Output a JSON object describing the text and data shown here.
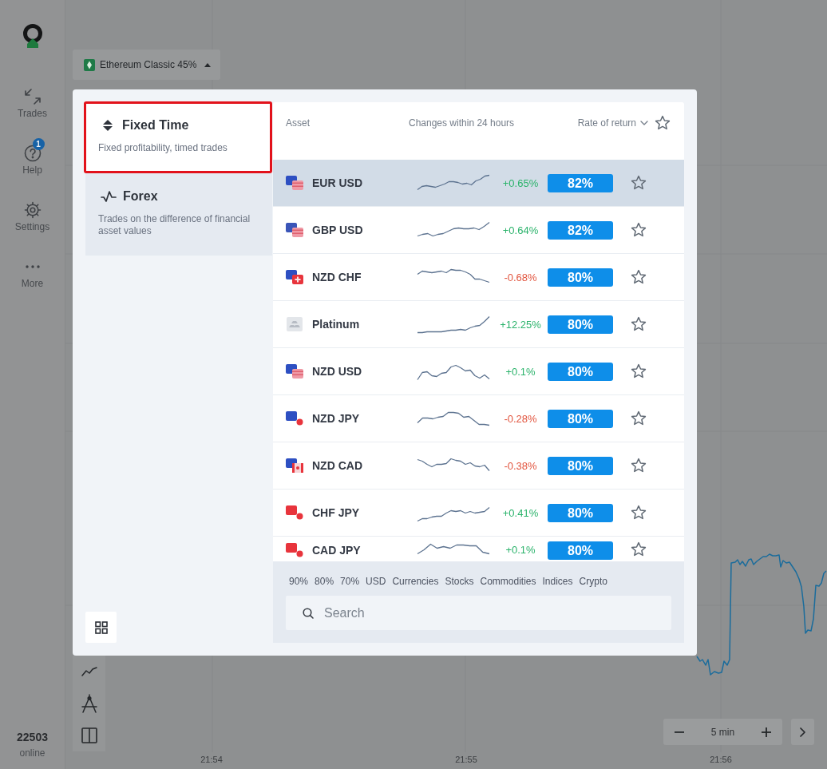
{
  "sidebar": {
    "items": [
      {
        "label": "Trades"
      },
      {
        "label": "Help",
        "badge": "1"
      },
      {
        "label": "Settings"
      },
      {
        "label": "More"
      }
    ],
    "online_count": "22503",
    "online_label": "online"
  },
  "asset_selector": {
    "name": "Ethereum Classic",
    "percent": "45%",
    "expanded": true
  },
  "asset_dialog": {
    "tabs": [
      {
        "title": "Fixed Time",
        "description": "Fixed profitability, timed trades",
        "selected": true
      },
      {
        "title": "Forex",
        "description": "Trades on the difference of financial asset values",
        "selected": false
      }
    ],
    "table": {
      "columns": [
        "Asset",
        "Changes within 24 hours",
        "Rate of return"
      ],
      "rows": [
        {
          "name": "EUR USD",
          "kind": "currency",
          "change": "+0.65%",
          "color": "#2bb36b",
          "rate": "82%",
          "selected": true,
          "favorite": false
        },
        {
          "name": "GBP USD",
          "kind": "currency",
          "change": "+0.64%",
          "color": "#2bb36b",
          "rate": "82%",
          "selected": false,
          "favorite": false
        },
        {
          "name": "NZD CHF",
          "kind": "currency",
          "change": "-0.68%",
          "color": "#e2553f",
          "rate": "80%",
          "selected": false,
          "favorite": false
        },
        {
          "name": "Platinum",
          "kind": "commodity",
          "change": "+12.25%",
          "color": "#2bb36b",
          "rate": "80%",
          "selected": false,
          "favorite": false
        },
        {
          "name": "NZD USD",
          "kind": "currency",
          "change": "+0.1%",
          "color": "#2bb36b",
          "rate": "80%",
          "selected": false,
          "favorite": false
        },
        {
          "name": "NZD JPY",
          "kind": "currency",
          "change": "-0.28%",
          "color": "#e2553f",
          "rate": "80%",
          "selected": false,
          "favorite": false
        },
        {
          "name": "NZD CAD",
          "kind": "currency",
          "change": "-0.38%",
          "color": "#e2553f",
          "rate": "80%",
          "selected": false,
          "favorite": false
        },
        {
          "name": "CHF JPY",
          "kind": "currency",
          "change": "+0.41%",
          "color": "#2bb36b",
          "rate": "80%",
          "selected": false,
          "favorite": false
        },
        {
          "name": "CAD JPY",
          "kind": "currency",
          "change": "+0.1%",
          "color": "#2bb36b",
          "rate": "80%",
          "selected": false,
          "favorite": false
        }
      ]
    },
    "filters": [
      "90%",
      "80%",
      "70%",
      "USD",
      "Currencies",
      "Stocks",
      "Commodities",
      "Indices",
      "Crypto"
    ],
    "search": {
      "placeholder": "Search"
    }
  },
  "chart": {
    "interval": "5 min",
    "time_labels": [
      "21:54",
      "21:55",
      "21:56"
    ]
  }
}
